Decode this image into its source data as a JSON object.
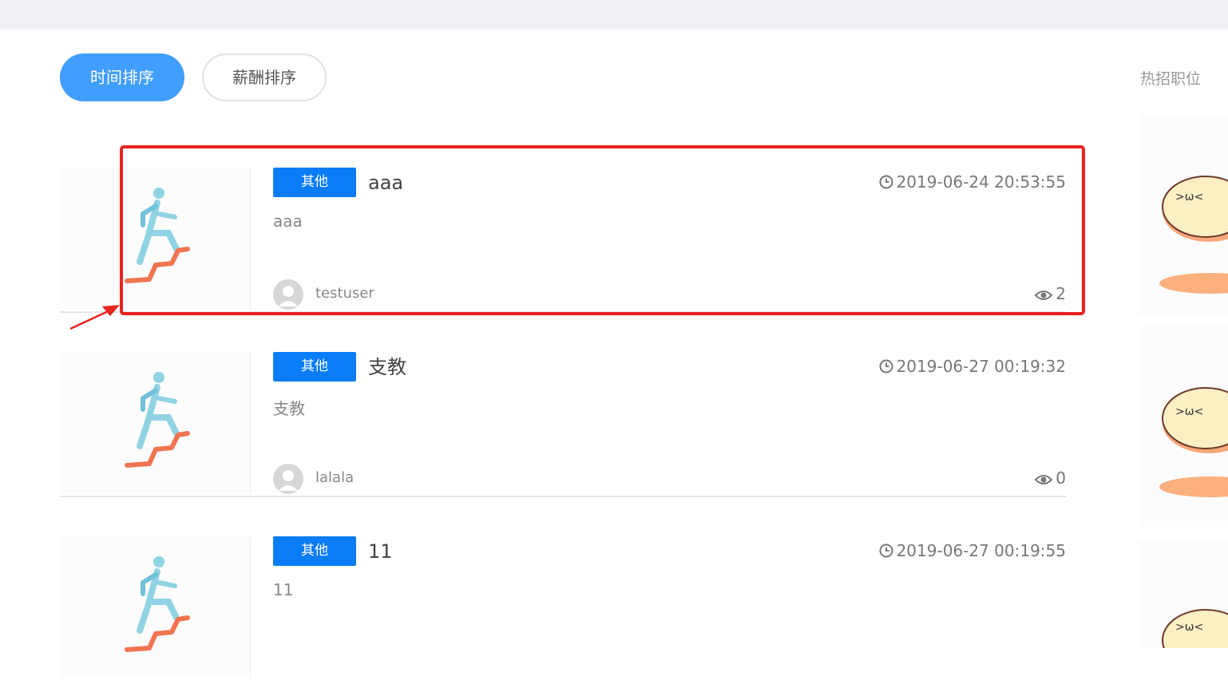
{
  "sort": {
    "time_label": "时间排序",
    "salary_label": "薪酬排序"
  },
  "sidebar": {
    "title": "热招职位"
  },
  "jobs": [
    {
      "tag": "其他",
      "title": "aaa",
      "time": "2019-06-24 20:53:55",
      "desc": "aaa",
      "user": "testuser",
      "views": "2"
    },
    {
      "tag": "其他",
      "title": "支教",
      "time": "2019-06-27 00:19:32",
      "desc": "支教",
      "user": "lalala",
      "views": "0"
    },
    {
      "tag": "其他",
      "title": "11",
      "time": "2019-06-27 00:19:55",
      "desc": "11",
      "user": "",
      "views": ""
    }
  ],
  "mascot": {
    "face": ">ω<"
  },
  "colors": {
    "accent": "#409eff",
    "tag": "#0a7cf6",
    "highlight": "#e8231e"
  },
  "icons": [
    "clock-icon",
    "eye-icon",
    "user-avatar-icon",
    "runner-stairs-icon"
  ]
}
